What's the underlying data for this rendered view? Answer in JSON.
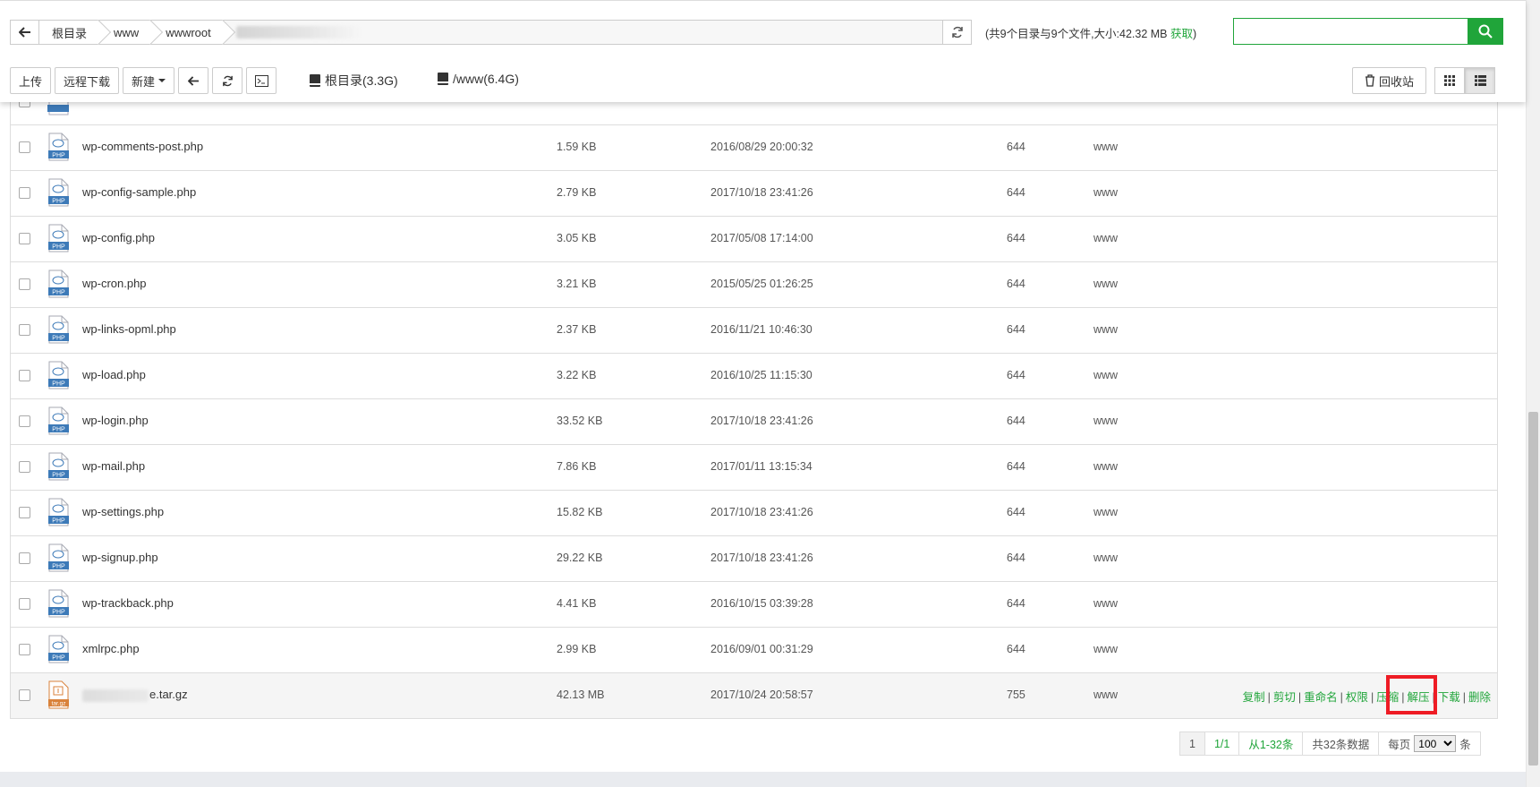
{
  "path": {
    "back_icon": "arrow-left-icon",
    "crumbs": [
      "根目录",
      "www",
      "wwwroot"
    ],
    "refresh_icon": "refresh-icon"
  },
  "summary": {
    "text": "(共9个目录与9个文件,大小:42.32 MB ",
    "fetch": "获取",
    "close": ")"
  },
  "search": {
    "value": "",
    "placeholder": "",
    "icon": "search-icon"
  },
  "toolbar": {
    "upload": "上传",
    "remote_download": "远程下载",
    "new": "新建",
    "disks": [
      "根目录(3.3G)",
      "/www(6.4G)"
    ],
    "recycle": "回收站"
  },
  "files": [
    {
      "name": "wp-comments-post.php",
      "size": "1.59 KB",
      "date": "2016/08/29 20:00:32",
      "perm": "644",
      "owner": "www",
      "type": "php"
    },
    {
      "name": "wp-config-sample.php",
      "size": "2.79 KB",
      "date": "2017/10/18 23:41:26",
      "perm": "644",
      "owner": "www",
      "type": "php"
    },
    {
      "name": "wp-config.php",
      "size": "3.05 KB",
      "date": "2017/05/08 17:14:00",
      "perm": "644",
      "owner": "www",
      "type": "php"
    },
    {
      "name": "wp-cron.php",
      "size": "3.21 KB",
      "date": "2015/05/25 01:26:25",
      "perm": "644",
      "owner": "www",
      "type": "php"
    },
    {
      "name": "wp-links-opml.php",
      "size": "2.37 KB",
      "date": "2016/11/21 10:46:30",
      "perm": "644",
      "owner": "www",
      "type": "php"
    },
    {
      "name": "wp-load.php",
      "size": "3.22 KB",
      "date": "2016/10/25 11:15:30",
      "perm": "644",
      "owner": "www",
      "type": "php"
    },
    {
      "name": "wp-login.php",
      "size": "33.52 KB",
      "date": "2017/10/18 23:41:26",
      "perm": "644",
      "owner": "www",
      "type": "php"
    },
    {
      "name": "wp-mail.php",
      "size": "7.86 KB",
      "date": "2017/01/11 13:15:34",
      "perm": "644",
      "owner": "www",
      "type": "php"
    },
    {
      "name": "wp-settings.php",
      "size": "15.82 KB",
      "date": "2017/10/18 23:41:26",
      "perm": "644",
      "owner": "www",
      "type": "php"
    },
    {
      "name": "wp-signup.php",
      "size": "29.22 KB",
      "date": "2017/10/18 23:41:26",
      "perm": "644",
      "owner": "www",
      "type": "php"
    },
    {
      "name": "wp-trackback.php",
      "size": "4.41 KB",
      "date": "2016/10/15 03:39:28",
      "perm": "644",
      "owner": "www",
      "type": "php"
    },
    {
      "name": "xmlrpc.php",
      "size": "2.99 KB",
      "date": "2016/09/01 00:31:29",
      "perm": "644",
      "owner": "www",
      "type": "php"
    },
    {
      "name": "e.tar.gz",
      "size": "42.13 MB",
      "date": "2017/10/24 20:58:57",
      "perm": "755",
      "owner": "www",
      "type": "tar.gz"
    }
  ],
  "icon_labels": {
    "php": "PHP",
    "gz": "tar.gz"
  },
  "ops": [
    "复制",
    "剪切",
    "重命名",
    "权限",
    "压缩",
    "解压",
    "下载",
    "删除"
  ],
  "pager": {
    "page": "1",
    "pages": "1/1",
    "range": "从1-32条",
    "total": "共32条数据",
    "per_page_label": "每页",
    "per_page": "100",
    "unit": "条"
  },
  "colors": {
    "accent": "#20a53a",
    "highlight": "#ee1c25"
  }
}
